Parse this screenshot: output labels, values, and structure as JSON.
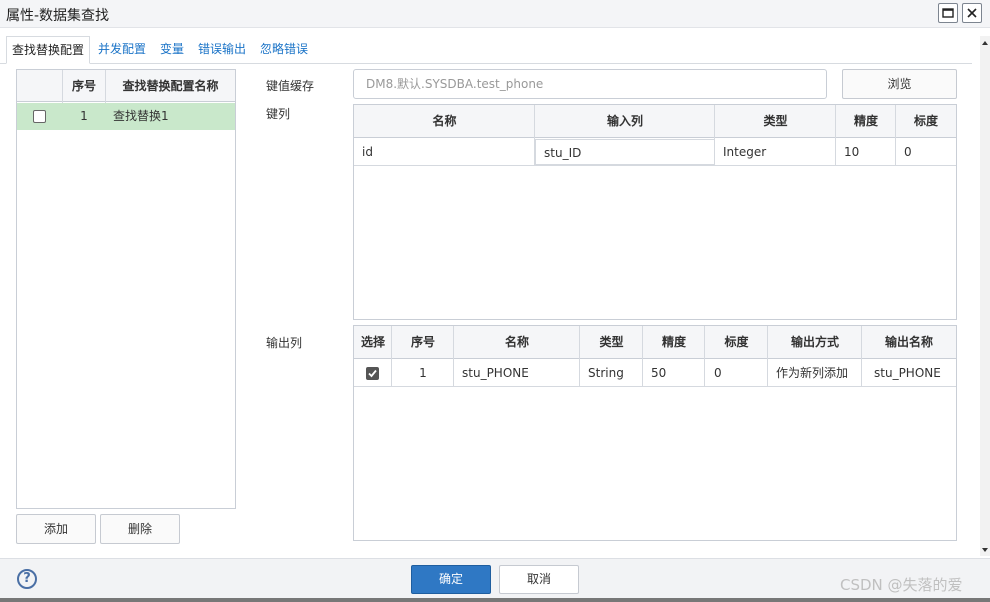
{
  "window": {
    "title": "属性-数据集查找"
  },
  "tabs": [
    {
      "label": "查找替换配置"
    },
    {
      "label": "并发配置"
    },
    {
      "label": "变量"
    },
    {
      "label": "错误输出"
    },
    {
      "label": "忽略错误"
    }
  ],
  "left_panel": {
    "headers": {
      "seq": "序号",
      "name": "查找替换配置名称"
    },
    "rows": [
      {
        "checked": false,
        "seq": "1",
        "name": "查找替换1"
      }
    ],
    "add_label": "添加",
    "delete_label": "删除"
  },
  "cache": {
    "label": "键值缓存",
    "value": "DM8.默认.SYSDBA.test_phone",
    "browse_label": "浏览"
  },
  "key_columns": {
    "label": "键列",
    "headers": {
      "name": "名称",
      "input": "输入列",
      "type": "类型",
      "precision": "精度",
      "scale": "标度"
    },
    "rows": [
      {
        "name": "id",
        "input": "stu_ID",
        "type": "Integer",
        "precision": "10",
        "scale": "0"
      }
    ]
  },
  "output_columns": {
    "label": "输出列",
    "headers": {
      "select": "选择",
      "seq": "序号",
      "name": "名称",
      "type": "类型",
      "precision": "精度",
      "scale": "标度",
      "mode": "输出方式",
      "out_name": "输出名称"
    },
    "rows": [
      {
        "selected": true,
        "seq": "1",
        "name": "stu_PHONE",
        "type": "String",
        "precision": "50",
        "scale": "0",
        "mode": "作为新列添加",
        "out_name": "stu_PHONE"
      }
    ]
  },
  "footer": {
    "ok_label": "确定",
    "cancel_label": "取消",
    "help_icon": "?",
    "watermark": "CSDN @失落的爱"
  },
  "colors": {
    "selected_row": "#c9e8cb",
    "primary": "#2f78c4",
    "tab_link": "#1a73c7"
  }
}
